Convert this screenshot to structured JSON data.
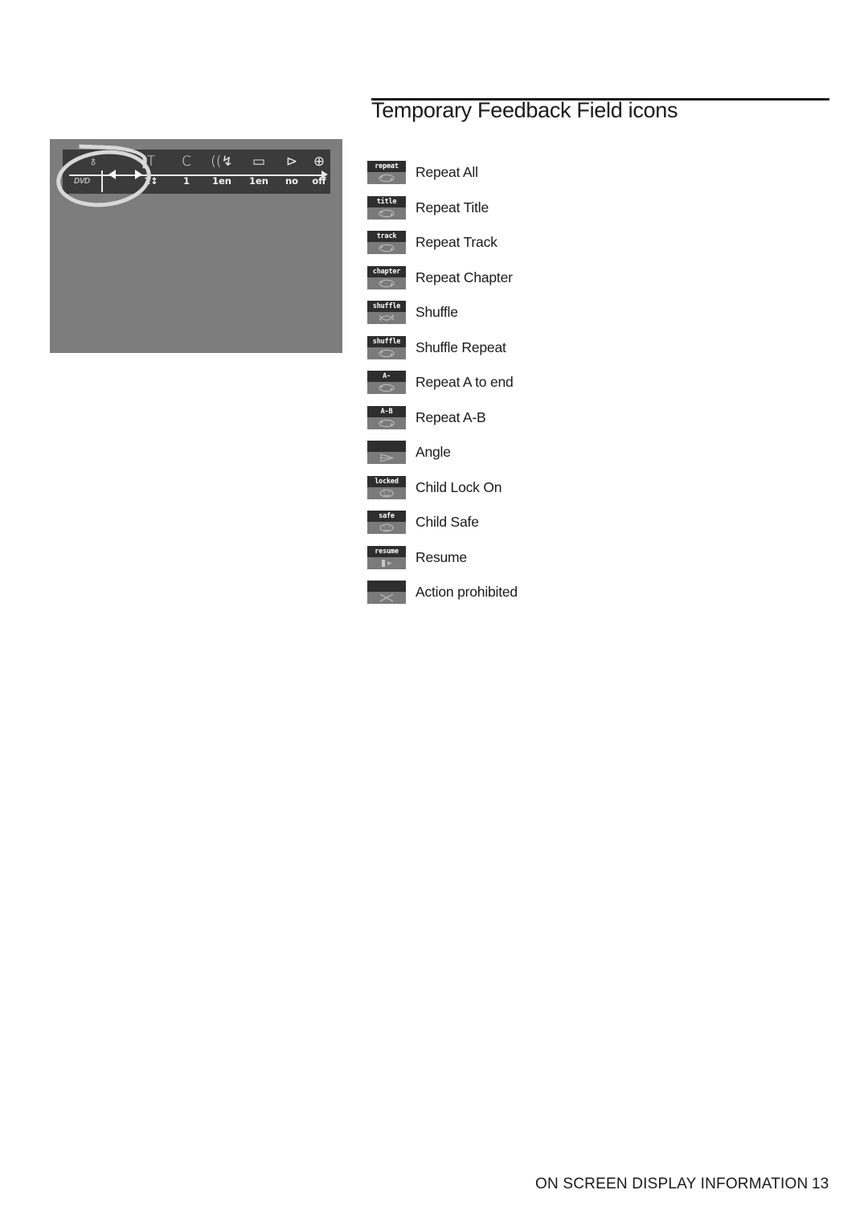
{
  "heading": {
    "title": "Temporary Feedback Field icons"
  },
  "screenshot": {
    "name": "osd-status-bar-screenshot",
    "disc_logo": "DVD",
    "osd_fields": [
      {
        "icon": "disc-time-icon",
        "glyph": "♁",
        "value": ""
      },
      {
        "icon": "title-icon",
        "glyph": "T",
        "value": "1↕"
      },
      {
        "icon": "chapter-icon",
        "glyph": "C",
        "value": "1"
      },
      {
        "icon": "audio-language-icon",
        "glyph": "((↯",
        "value": "1en"
      },
      {
        "icon": "subtitle-icon",
        "glyph": "▭",
        "value": "1en"
      },
      {
        "icon": "angle-icon",
        "glyph": "⊳",
        "value": "no"
      },
      {
        "icon": "zoom-icon",
        "glyph": "⊕",
        "value": "off"
      }
    ],
    "annotation": "hand-drawn-circle-highlight"
  },
  "legend": {
    "items": [
      {
        "icon_name": "repeat-all-icon",
        "badge_text": "repeat",
        "glyph": "loop",
        "label": "Repeat All"
      },
      {
        "icon_name": "repeat-title-icon",
        "badge_text": "title",
        "glyph": "loop",
        "label": "Repeat Title"
      },
      {
        "icon_name": "repeat-track-icon",
        "badge_text": "track",
        "glyph": "loop",
        "label": "Repeat Track"
      },
      {
        "icon_name": "repeat-chapter-icon",
        "badge_text": "chapter",
        "glyph": "loop",
        "label": "Repeat Chapter"
      },
      {
        "icon_name": "shuffle-icon",
        "badge_text": "shuffle",
        "glyph": "shuffle",
        "label": "Shuffle"
      },
      {
        "icon_name": "shuffle-repeat-icon",
        "badge_text": "shuffle",
        "glyph": "loop",
        "label": "Shuffle Repeat"
      },
      {
        "icon_name": "repeat-a-to-end-icon",
        "badge_text": "A-",
        "glyph": "loop",
        "label": "Repeat A to end"
      },
      {
        "icon_name": "repeat-a-b-icon",
        "badge_text": "A-B",
        "glyph": "loop",
        "label": "Repeat A-B"
      },
      {
        "icon_name": "angle-icon",
        "badge_text": "",
        "glyph": "angle",
        "label": "Angle"
      },
      {
        "icon_name": "child-lock-on-icon",
        "badge_text": "locked",
        "glyph": "face",
        "label": "Child Lock On"
      },
      {
        "icon_name": "child-safe-icon",
        "badge_text": "safe",
        "glyph": "face",
        "label": "Child Safe"
      },
      {
        "icon_name": "resume-icon",
        "badge_text": "resume",
        "glyph": "resume",
        "label": "Resume"
      },
      {
        "icon_name": "action-prohibited-icon",
        "badge_text": "",
        "glyph": "cross",
        "label": "Action prohibited"
      }
    ]
  },
  "footer": {
    "section_title": "ON SCREEN DISPLAY INFORMATION",
    "page_number": "13"
  },
  "colors": {
    "page_background": "#ffffff",
    "text": "#1a1a1a",
    "screenshot_background": "#7d7d7d",
    "osd_bar": "#3b3b3b",
    "icon_badge_top": "#2e2e2e",
    "icon_badge_bottom": "#7a7a7a",
    "annotation": "#d8d8d8"
  }
}
